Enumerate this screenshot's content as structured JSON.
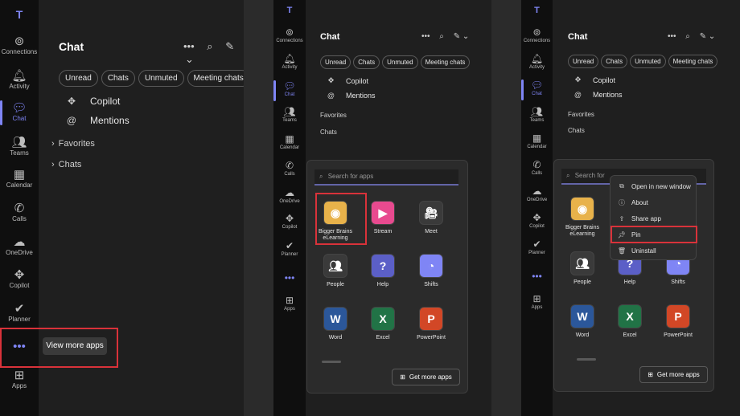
{
  "colors": {
    "accent": "#7f85f5",
    "highlight": "#d9323a",
    "background": "#1f1f1f",
    "rail": "#0f0f0f"
  },
  "rail": {
    "items": [
      {
        "label": "Connections",
        "icon": "connections-icon",
        "glyph": "⊚"
      },
      {
        "label": "Activity",
        "icon": "bell-icon",
        "glyph": "🔔︎"
      },
      {
        "label": "Chat",
        "icon": "chat-icon",
        "glyph": "💬︎"
      },
      {
        "label": "Teams",
        "icon": "teams-icon",
        "glyph": "👥︎"
      },
      {
        "label": "Calendar",
        "icon": "calendar-icon",
        "glyph": "▦"
      },
      {
        "label": "Calls",
        "icon": "phone-icon",
        "glyph": "✆"
      },
      {
        "label": "OneDrive",
        "icon": "cloud-icon",
        "glyph": "☁"
      },
      {
        "label": "Copilot",
        "icon": "copilot-icon",
        "glyph": "✥"
      },
      {
        "label": "Planner",
        "icon": "planner-icon",
        "glyph": "✔"
      },
      {
        "label": "...",
        "icon": "more-apps-icon",
        "glyph": "•••"
      },
      {
        "label": "Apps",
        "icon": "apps-icon",
        "glyph": "⊞"
      }
    ]
  },
  "chat": {
    "title": "Chat",
    "filters": [
      "Unread",
      "Chats",
      "Unmuted",
      "Meeting chats"
    ],
    "pinned": [
      {
        "label": "Copilot",
        "icon": "copilot-icon",
        "glyph": "✥"
      },
      {
        "label": "Mentions",
        "icon": "at-icon",
        "glyph": "@"
      }
    ],
    "sections": [
      "Favorites",
      "Chats"
    ]
  },
  "tooltip": {
    "label": "View more apps"
  },
  "flyout": {
    "search_placeholder": "Search for apps",
    "search_placeholder_short": "Search for",
    "apps": [
      {
        "label": "Bigger Brains eLearning",
        "icon": "bigger-brains-icon",
        "glyph": "◉",
        "color": "#e8b24a"
      },
      {
        "label": "Stream",
        "icon": "stream-icon",
        "glyph": "▶",
        "color": "#e84a8f"
      },
      {
        "label": "Meet",
        "icon": "meet-icon",
        "glyph": "🎥︎",
        "color": "#3a3a3a"
      },
      {
        "label": "People",
        "icon": "people-icon",
        "glyph": "👥︎",
        "color": "#3a3a3a"
      },
      {
        "label": "Help",
        "icon": "help-icon",
        "glyph": "?",
        "color": "#5b5fc7"
      },
      {
        "label": "Shifts",
        "icon": "shifts-icon",
        "glyph": "◔",
        "color": "#7f85f5"
      },
      {
        "label": "Word",
        "icon": "word-icon",
        "glyph": "W",
        "color": "#2b579a"
      },
      {
        "label": "Excel",
        "icon": "excel-icon",
        "glyph": "X",
        "color": "#217346"
      },
      {
        "label": "PowerPoint",
        "icon": "powerpoint-icon",
        "glyph": "P",
        "color": "#d24726"
      }
    ],
    "get_more": "Get more apps"
  },
  "context_menu": {
    "items": [
      {
        "label": "Open in new window",
        "icon": "open-window-icon",
        "glyph": "⧉"
      },
      {
        "label": "About",
        "icon": "info-icon",
        "glyph": "ⓘ"
      },
      {
        "label": "Share app",
        "icon": "share-icon",
        "glyph": "⇪"
      },
      {
        "label": "Pin",
        "icon": "pin-icon",
        "glyph": "📌︎"
      },
      {
        "label": "Uninstall",
        "icon": "trash-icon",
        "glyph": "🗑︎"
      }
    ]
  }
}
